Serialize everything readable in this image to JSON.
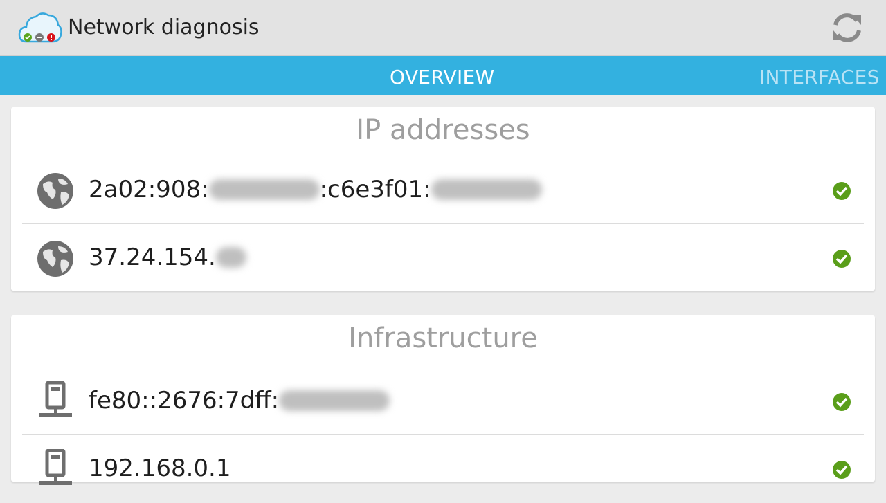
{
  "app": {
    "title": "Network diagnosis",
    "icon": "cloud-status-icon",
    "refresh_icon": "refresh-icon"
  },
  "tabs": [
    {
      "label": "OVERVIEW",
      "active": true
    },
    {
      "label": "INTERFACES",
      "active": false
    }
  ],
  "colors": {
    "tabbar": "#33b1e0",
    "ok": "#5a9e1a",
    "card_title": "#9e9e9e"
  },
  "sections": [
    {
      "title": "IP addresses",
      "items": [
        {
          "icon": "globe-icon",
          "prefix": "2a02:908:",
          "middle": ":c6e3f01:",
          "status": "ok"
        },
        {
          "icon": "globe-icon",
          "prefix": "37.24.154.",
          "status": "ok"
        }
      ]
    },
    {
      "title": "Infrastructure",
      "items": [
        {
          "icon": "router-icon",
          "prefix": "fe80::2676:7dff:",
          "status": "ok"
        },
        {
          "icon": "router-icon",
          "prefix": "192.168.0.1",
          "status": "ok"
        }
      ]
    }
  ]
}
